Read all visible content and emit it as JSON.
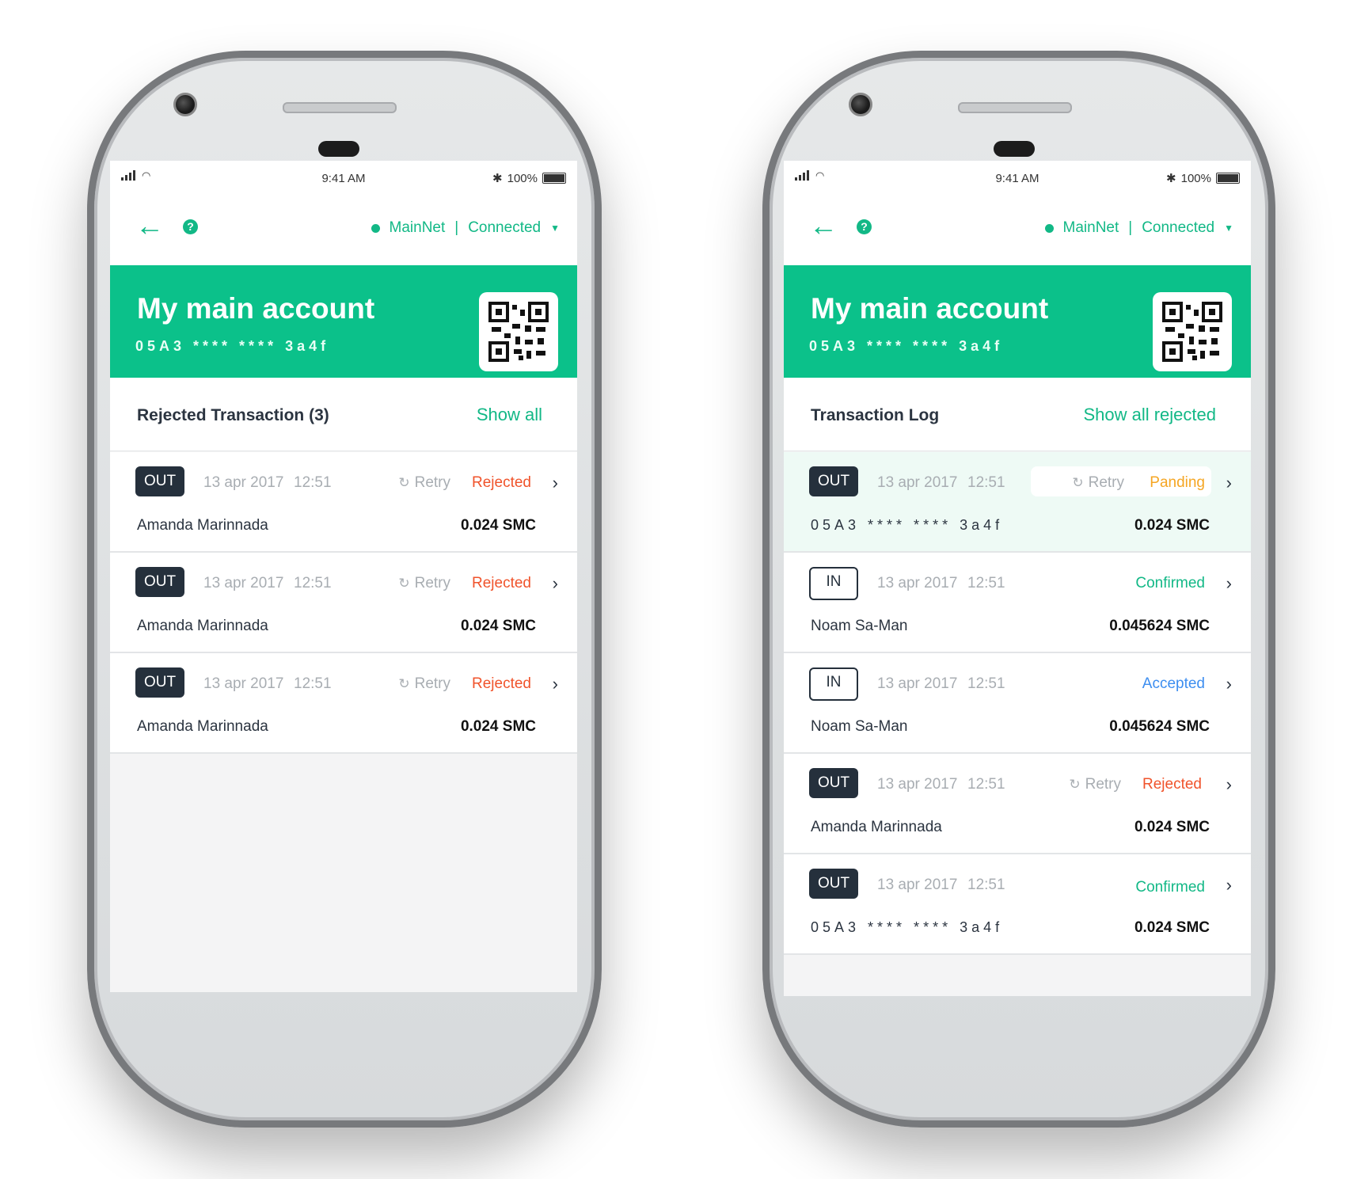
{
  "status_bar": {
    "time": "9:41 AM",
    "battery": "100%",
    "bluetooth_icon": "bluetooth-icon",
    "signal_icon": "signal-icon",
    "wifi_icon": "wifi-icon"
  },
  "network": {
    "name": "MainNet",
    "separator": "|",
    "state": "Connected"
  },
  "account": {
    "title": "My main account",
    "address": "05A3 **** **** 3a4f"
  },
  "colors": {
    "accent": "#0bc18a",
    "rejected": "#f0532b",
    "pending": "#f5a623",
    "accepted": "#3d8ef0",
    "badge_dark": "#25303c"
  },
  "phone1": {
    "section_title": "Rejected Transaction (3)",
    "section_action": "Show all",
    "transactions": [
      {
        "direction": "OUT",
        "date": "13 apr 2017",
        "time": "12:51",
        "retry": "Retry",
        "status": "Rejected",
        "party": "Amanda Marinnada",
        "amount": "0.024 SMC"
      },
      {
        "direction": "OUT",
        "date": "13 apr 2017",
        "time": "12:51",
        "retry": "Retry",
        "status": "Rejected",
        "party": "Amanda Marinnada",
        "amount": "0.024 SMC"
      },
      {
        "direction": "OUT",
        "date": "13 apr 2017",
        "time": "12:51",
        "retry": "Retry",
        "status": "Rejected",
        "party": "Amanda Marinnada",
        "amount": "0.024 SMC"
      }
    ]
  },
  "phone2": {
    "section_title": "Transaction Log",
    "section_action": "Show all rejected",
    "transactions": [
      {
        "direction": "OUT",
        "date": "13 apr 2017",
        "time": "12:51",
        "retry": "Retry",
        "status": "Panding",
        "party": "05A3 **** **** 3a4f",
        "amount": "0.024 SMC"
      },
      {
        "direction": "IN",
        "date": "13 apr 2017",
        "time": "12:51",
        "status": "Confirmed",
        "party": "Noam Sa-Man",
        "amount": "0.045624 SMC"
      },
      {
        "direction": "IN",
        "date": "13 apr 2017",
        "time": "12:51",
        "status": "Accepted",
        "party": "Noam Sa-Man",
        "amount": "0.045624 SMC"
      },
      {
        "direction": "OUT",
        "date": "13 apr 2017",
        "time": "12:51",
        "retry": "Retry",
        "status": "Rejected",
        "party": "Amanda Marinnada",
        "amount": "0.024 SMC"
      },
      {
        "direction": "OUT",
        "date": "13 apr 2017",
        "time": "12:51",
        "status": "Confirmed",
        "party": "05A3 **** **** 3a4f",
        "amount": "0.024 SMC"
      }
    ]
  }
}
